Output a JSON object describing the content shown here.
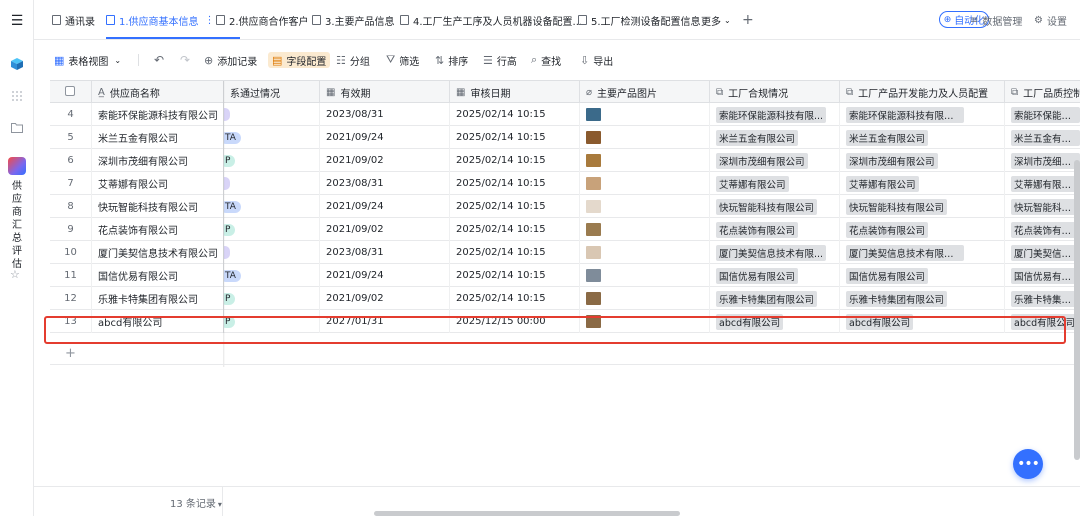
{
  "tabs": {
    "items": [
      {
        "label": "通讯录",
        "active": false
      },
      {
        "label": "1.供应商基本信息",
        "active": true
      },
      {
        "label": "2.供应商合作客户",
        "active": false
      },
      {
        "label": "3.主要产品信息",
        "active": false
      },
      {
        "label": "4.工厂生产工序及人员机器设备配置...",
        "active": false
      },
      {
        "label": "5.工厂检测设备配置信息",
        "active": false
      }
    ],
    "more_label": "更多",
    "add_icon": "plus-icon",
    "auto_label": "自动化",
    "data_manage_label": "数据管理",
    "settings_label": "设置"
  },
  "toolbar": {
    "view_label": "表格视图",
    "add_record": "添加记录",
    "field_config": "字段配置",
    "group": "分组",
    "filter": "筛选",
    "sort": "排序",
    "row_height": "行高",
    "search": "查找",
    "export": "导出"
  },
  "sidebar": {
    "app_label": "供应商汇总评估"
  },
  "columns": {
    "name": "供应商名称",
    "pass_status": "系通过情况",
    "valid_until": "有效期",
    "review_date": "审核日期",
    "product_image": "主要产品图片",
    "factory_compliance": "工厂合规情况",
    "factory_dev": "工厂产品开发能力及人员配置",
    "factory_qc": "工厂品质控制"
  },
  "rows": [
    {
      "num": "4",
      "name": "索能环保能源科技有限公司",
      "pill": "",
      "pill_color": "#d9d4f7",
      "valid": "2023/08/31",
      "review": "2025/02/14 10:15",
      "compliance": "索能环保能源科技有限...",
      "dev": "索能环保能源科技有限公司",
      "qc": "索能环保能源科",
      "thumb": "#3b6a8a"
    },
    {
      "num": "5",
      "name": "米兰五金有限公司",
      "pill": "TA",
      "pill_color": "#c9d9fb",
      "valid": "2021/09/24",
      "review": "2025/02/14 10:15",
      "compliance": "米兰五金有限公司",
      "dev": "米兰五金有限公司",
      "qc": "米兰五金有限公",
      "thumb": "#8a5a2e"
    },
    {
      "num": "6",
      "name": "深圳市茂细有限公司",
      "pill": "P",
      "pill_color": "#c9efe6",
      "valid": "2021/09/02",
      "review": "2025/02/14 10:15",
      "compliance": "深圳市茂细有限公司",
      "dev": "深圳市茂细有限公司",
      "qc": "深圳市茂细有限",
      "thumb": "#a87a3c"
    },
    {
      "num": "7",
      "name": "艾蒂娜有限公司",
      "pill": "",
      "pill_color": "#d9d4f7",
      "valid": "2023/08/31",
      "review": "2025/02/14 10:15",
      "compliance": "艾蒂娜有限公司",
      "dev": "艾蒂娜有限公司",
      "qc": "艾蒂娜有限公司",
      "thumb": "#c8a27a"
    },
    {
      "num": "8",
      "name": "快玩智能科技有限公司",
      "pill": "TA",
      "pill_color": "#c9d9fb",
      "valid": "2021/09/24",
      "review": "2025/02/14 10:15",
      "compliance": "快玩智能科技有限公司",
      "dev": "快玩智能科技有限公司",
      "qc": "快玩智能科技有",
      "thumb": "#e4d9cc"
    },
    {
      "num": "9",
      "name": "花点装饰有限公司",
      "pill": "P",
      "pill_color": "#c9efe6",
      "valid": "2021/09/02",
      "review": "2025/02/14 10:15",
      "compliance": "花点装饰有限公司",
      "dev": "花点装饰有限公司",
      "qc": "花点装饰有限公",
      "thumb": "#9a7b4f"
    },
    {
      "num": "10",
      "name": "厦门美契信息技术有限公司",
      "pill": "",
      "pill_color": "#d9d4f7",
      "valid": "2023/08/31",
      "review": "2025/02/14 10:15",
      "compliance": "厦门美契信息技术有限...",
      "dev": "厦门美契信息技术有限公司",
      "qc": "厦门美契信息技",
      "thumb": "#d9c7b3"
    },
    {
      "num": "11",
      "name": "国信优易有限公司",
      "pill": "TA",
      "pill_color": "#c9d9fb",
      "valid": "2021/09/24",
      "review": "2025/02/14 10:15",
      "compliance": "国信优易有限公司",
      "dev": "国信优易有限公司",
      "qc": "国信优易有限公",
      "thumb": "#7f8c9a"
    },
    {
      "num": "12",
      "name": "乐雅卡特集团有限公司",
      "pill": "P",
      "pill_color": "#c9efe6",
      "valid": "2021/09/02",
      "review": "2025/02/14 10:15",
      "compliance": "乐雅卡特集团有限公司",
      "dev": "乐雅卡特集团有限公司",
      "qc": "乐雅卡特集团有",
      "thumb": "#8a6a45"
    },
    {
      "num": "13",
      "name": "abcd有限公司",
      "pill": "P",
      "pill_color": "#c9efe6",
      "valid": "2027/01/31",
      "review": "2025/12/15 00:00",
      "compliance": "abcd有限公司",
      "dev": "abcd有限公司",
      "qc": "abcd有限公司",
      "thumb": "#8a6a45"
    }
  ],
  "footer": {
    "count_label": "13 条记录"
  }
}
